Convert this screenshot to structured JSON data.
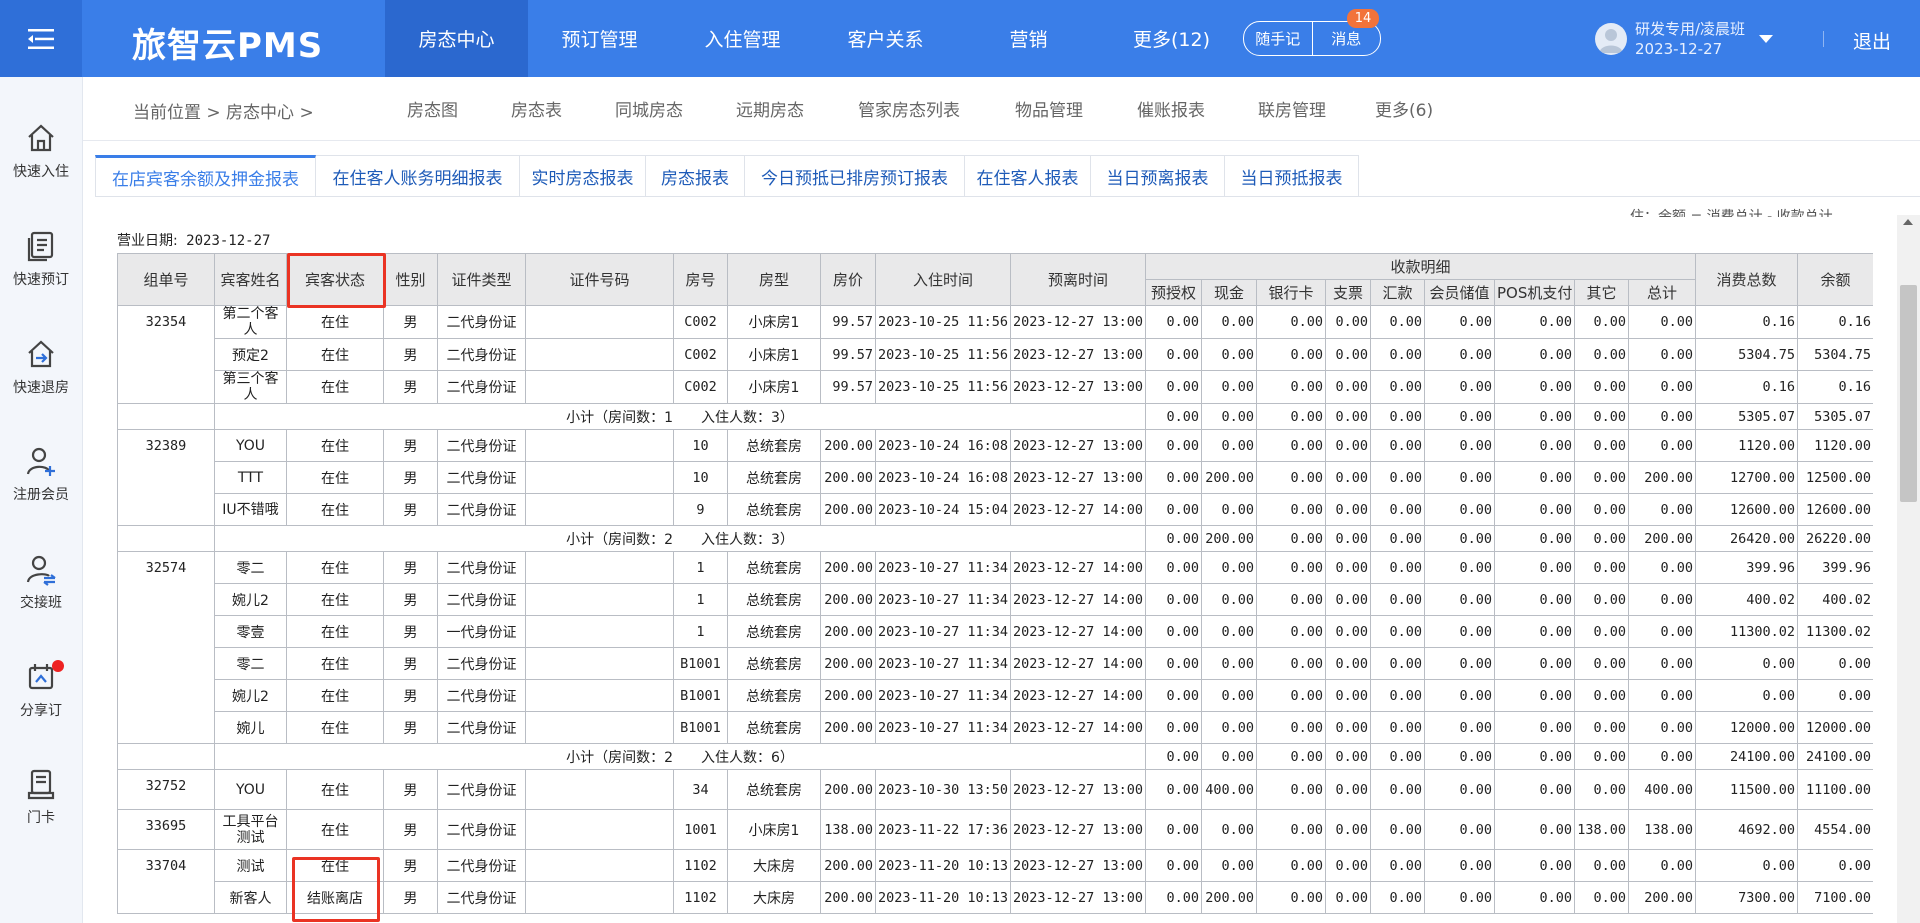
{
  "topbar": {
    "brand": "旅智云PMS",
    "nav": [
      "房态中心",
      "预订管理",
      "入住管理",
      "客户关系",
      "营销",
      "更多(12)"
    ],
    "active_nav": 0,
    "notes_label": "随手记",
    "messages_label": "消息",
    "messages_badge": "14",
    "user_name": "研发专用/凌晨班",
    "user_date": "2023-12-27",
    "logout_label": "退出"
  },
  "sidebar": [
    "快速入住",
    "快速预订",
    "快速退房",
    "注册会员",
    "交接班",
    "分享订",
    "门卡"
  ],
  "breadcrumb": "当前位置 > 房态中心 >",
  "subnav": [
    "房态图",
    "房态表",
    "同城房态",
    "远期房态",
    "管家房态列表",
    "物品管理",
    "催账报表",
    "联房管理",
    "更多(6)"
  ],
  "tabs": [
    "在店宾客余额及押金报表",
    "在住客人账务明细报表",
    "实时房态报表",
    "房态报表",
    "今日预抵已排房预订报表",
    "在住客人报表",
    "当日预离报表",
    "当日预抵报表"
  ],
  "active_tab": 0,
  "clipped_header_text": "住：余额 = 消费总计 - 收款总计",
  "business_date_label": "营业日期:",
  "business_date": "2023-12-27",
  "table": {
    "headers": {
      "group_no": "组单号",
      "guest_name": "宾客姓名",
      "guest_status": "宾客状态",
      "gender": "性别",
      "id_type": "证件类型",
      "id_no": "证件号码",
      "room_no": "房号",
      "room_type": "房型",
      "price": "房价",
      "checkin": "入住时间",
      "checkout": "预离时间",
      "payments_group": "收款明细",
      "payments": [
        "预授权",
        "现金",
        "银行卡",
        "支票",
        "汇款",
        "会员储值",
        "POS机支付",
        "其它",
        "总计"
      ],
      "consumption_total": "消费总数",
      "balance": "余额"
    },
    "groups": [
      {
        "group_no": "32354",
        "rows": [
          {
            "name": "第二个客人",
            "status": "在住",
            "gender": "男",
            "id_type": "二代身份证",
            "id_no": "",
            "room": "C002",
            "room_type": "小床房1",
            "price": "99.57",
            "checkin": "2023-10-25 11:56",
            "checkout": "2023-12-27 13:00",
            "pay": [
              "0.00",
              "0.00",
              "0.00",
              "0.00",
              "0.00",
              "0.00",
              "0.00",
              "0.00",
              "0.00"
            ],
            "consume": "0.16",
            "balance": "0.16"
          },
          {
            "name": "预定2",
            "status": "在住",
            "gender": "男",
            "id_type": "二代身份证",
            "id_no": "",
            "room": "C002",
            "room_type": "小床房1",
            "price": "99.57",
            "checkin": "2023-10-25 11:56",
            "checkout": "2023-12-27 13:00",
            "pay": [
              "0.00",
              "0.00",
              "0.00",
              "0.00",
              "0.00",
              "0.00",
              "0.00",
              "0.00",
              "0.00"
            ],
            "consume": "5304.75",
            "balance": "5304.75"
          },
          {
            "name": "第三个客人",
            "status": "在住",
            "gender": "男",
            "id_type": "二代身份证",
            "id_no": "",
            "room": "C002",
            "room_type": "小床房1",
            "price": "99.57",
            "checkin": "2023-10-25 11:56",
            "checkout": "2023-12-27 13:00",
            "pay": [
              "0.00",
              "0.00",
              "0.00",
              "0.00",
              "0.00",
              "0.00",
              "0.00",
              "0.00",
              "0.00"
            ],
            "consume": "0.16",
            "balance": "0.16"
          }
        ],
        "subtotal": {
          "label": "小计（房间数：1　　入住人数：3）",
          "pay": [
            "0.00",
            "0.00",
            "0.00",
            "0.00",
            "0.00",
            "0.00",
            "0.00",
            "0.00",
            "0.00"
          ],
          "consume": "5305.07",
          "balance": "5305.07"
        }
      },
      {
        "group_no": "32389",
        "rows": [
          {
            "name": "YOU",
            "status": "在住",
            "gender": "男",
            "id_type": "二代身份证",
            "id_no": "",
            "room": "10",
            "room_type": "总统套房",
            "price": "200.00",
            "checkin": "2023-10-24 16:08",
            "checkout": "2023-12-27 13:00",
            "pay": [
              "0.00",
              "0.00",
              "0.00",
              "0.00",
              "0.00",
              "0.00",
              "0.00",
              "0.00",
              "0.00"
            ],
            "consume": "1120.00",
            "balance": "1120.00"
          },
          {
            "name": "TTT",
            "status": "在住",
            "gender": "男",
            "id_type": "二代身份证",
            "id_no": "",
            "room": "10",
            "room_type": "总统套房",
            "price": "200.00",
            "checkin": "2023-10-24 16:08",
            "checkout": "2023-12-27 13:00",
            "pay": [
              "0.00",
              "200.00",
              "0.00",
              "0.00",
              "0.00",
              "0.00",
              "0.00",
              "0.00",
              "200.00"
            ],
            "consume": "12700.00",
            "balance": "12500.00"
          },
          {
            "name": "IU不错哦",
            "status": "在住",
            "gender": "男",
            "id_type": "二代身份证",
            "id_no": "",
            "room": "9",
            "room_type": "总统套房",
            "price": "200.00",
            "checkin": "2023-10-24 15:04",
            "checkout": "2023-12-27 14:00",
            "pay": [
              "0.00",
              "0.00",
              "0.00",
              "0.00",
              "0.00",
              "0.00",
              "0.00",
              "0.00",
              "0.00"
            ],
            "consume": "12600.00",
            "balance": "12600.00"
          }
        ],
        "subtotal": {
          "label": "小计（房间数：2　　入住人数：3）",
          "pay": [
            "0.00",
            "200.00",
            "0.00",
            "0.00",
            "0.00",
            "0.00",
            "0.00",
            "0.00",
            "200.00"
          ],
          "consume": "26420.00",
          "balance": "26220.00"
        }
      },
      {
        "group_no": "32574",
        "rows": [
          {
            "name": "零二",
            "status": "在住",
            "gender": "男",
            "id_type": "二代身份证",
            "id_no": "",
            "room": "1",
            "room_type": "总统套房",
            "price": "200.00",
            "checkin": "2023-10-27 11:34",
            "checkout": "2023-12-27 14:00",
            "pay": [
              "0.00",
              "0.00",
              "0.00",
              "0.00",
              "0.00",
              "0.00",
              "0.00",
              "0.00",
              "0.00"
            ],
            "consume": "399.96",
            "balance": "399.96"
          },
          {
            "name": "婉儿2",
            "status": "在住",
            "gender": "男",
            "id_type": "二代身份证",
            "id_no": "",
            "room": "1",
            "room_type": "总统套房",
            "price": "200.00",
            "checkin": "2023-10-27 11:34",
            "checkout": "2023-12-27 14:00",
            "pay": [
              "0.00",
              "0.00",
              "0.00",
              "0.00",
              "0.00",
              "0.00",
              "0.00",
              "0.00",
              "0.00"
            ],
            "consume": "400.02",
            "balance": "400.02"
          },
          {
            "name": "零壹",
            "status": "在住",
            "gender": "男",
            "id_type": "一代身份证",
            "id_no": "",
            "room": "1",
            "room_type": "总统套房",
            "price": "200.00",
            "checkin": "2023-10-27 11:34",
            "checkout": "2023-12-27 14:00",
            "pay": [
              "0.00",
              "0.00",
              "0.00",
              "0.00",
              "0.00",
              "0.00",
              "0.00",
              "0.00",
              "0.00"
            ],
            "consume": "11300.02",
            "balance": "11300.02"
          },
          {
            "name": "零二",
            "status": "在住",
            "gender": "男",
            "id_type": "二代身份证",
            "id_no": "",
            "room": "B1001",
            "room_type": "总统套房",
            "price": "200.00",
            "checkin": "2023-10-27 11:34",
            "checkout": "2023-12-27 14:00",
            "pay": [
              "0.00",
              "0.00",
              "0.00",
              "0.00",
              "0.00",
              "0.00",
              "0.00",
              "0.00",
              "0.00"
            ],
            "consume": "0.00",
            "balance": "0.00"
          },
          {
            "name": "婉儿2",
            "status": "在住",
            "gender": "男",
            "id_type": "二代身份证",
            "id_no": "",
            "room": "B1001",
            "room_type": "总统套房",
            "price": "200.00",
            "checkin": "2023-10-27 11:34",
            "checkout": "2023-12-27 14:00",
            "pay": [
              "0.00",
              "0.00",
              "0.00",
              "0.00",
              "0.00",
              "0.00",
              "0.00",
              "0.00",
              "0.00"
            ],
            "consume": "0.00",
            "balance": "0.00"
          },
          {
            "name": "婉儿",
            "status": "在住",
            "gender": "男",
            "id_type": "二代身份证",
            "id_no": "",
            "room": "B1001",
            "room_type": "总统套房",
            "price": "200.00",
            "checkin": "2023-10-27 11:34",
            "checkout": "2023-12-27 14:00",
            "pay": [
              "0.00",
              "0.00",
              "0.00",
              "0.00",
              "0.00",
              "0.00",
              "0.00",
              "0.00",
              "0.00"
            ],
            "consume": "12000.00",
            "balance": "12000.00"
          }
        ],
        "subtotal": {
          "label": "小计（房间数：2　　入住人数：6）",
          "pay": [
            "0.00",
            "0.00",
            "0.00",
            "0.00",
            "0.00",
            "0.00",
            "0.00",
            "0.00",
            "0.00"
          ],
          "consume": "24100.00",
          "balance": "24100.00"
        }
      },
      {
        "group_no": "32752",
        "rows": [
          {
            "name": "YOU",
            "status": "在住",
            "gender": "男",
            "id_type": "二代身份证",
            "id_no": "",
            "room": "34",
            "room_type": "总统套房",
            "price": "200.00",
            "checkin": "2023-10-30 13:50",
            "checkout": "2023-12-27 13:00",
            "pay": [
              "0.00",
              "400.00",
              "0.00",
              "0.00",
              "0.00",
              "0.00",
              "0.00",
              "0.00",
              "400.00"
            ],
            "consume": "11500.00",
            "balance": "11100.00"
          }
        ]
      },
      {
        "group_no": "33695",
        "rows": [
          {
            "name": "工具平台测试",
            "status": "在住",
            "gender": "男",
            "id_type": "二代身份证",
            "id_no": "",
            "room": "1001",
            "room_type": "小床房1",
            "price": "138.00",
            "checkin": "2023-11-22 17:36",
            "checkout": "2023-12-27 13:00",
            "pay": [
              "0.00",
              "0.00",
              "0.00",
              "0.00",
              "0.00",
              "0.00",
              "0.00",
              "138.00",
              "138.00"
            ],
            "consume": "4692.00",
            "balance": "4554.00"
          }
        ]
      },
      {
        "group_no": "33704",
        "rows": [
          {
            "name": "测试",
            "status": "在住",
            "gender": "男",
            "id_type": "二代身份证",
            "id_no": "",
            "room": "1102",
            "room_type": "大床房",
            "price": "200.00",
            "checkin": "2023-11-20 10:13",
            "checkout": "2023-12-27 13:00",
            "pay": [
              "0.00",
              "0.00",
              "0.00",
              "0.00",
              "0.00",
              "0.00",
              "0.00",
              "0.00",
              "0.00"
            ],
            "consume": "0.00",
            "balance": "0.00"
          },
          {
            "name": "新客人",
            "status": "结账离店",
            "gender": "男",
            "id_type": "二代身份证",
            "id_no": "",
            "room": "1102",
            "room_type": "大床房",
            "price": "200.00",
            "checkin": "2023-11-20 10:13",
            "checkout": "2023-12-27 13:00",
            "pay": [
              "0.00",
              "200.00",
              "0.00",
              "0.00",
              "0.00",
              "0.00",
              "0.00",
              "0.00",
              "200.00"
            ],
            "consume": "7300.00",
            "balance": "7100.00"
          }
        ]
      }
    ]
  },
  "colors": {
    "primary": "#3a7ee8",
    "primary_dark": "#2b68cf",
    "badge": "#f2733a",
    "highlight": "#ea3323",
    "link": "#1e5bb8"
  }
}
